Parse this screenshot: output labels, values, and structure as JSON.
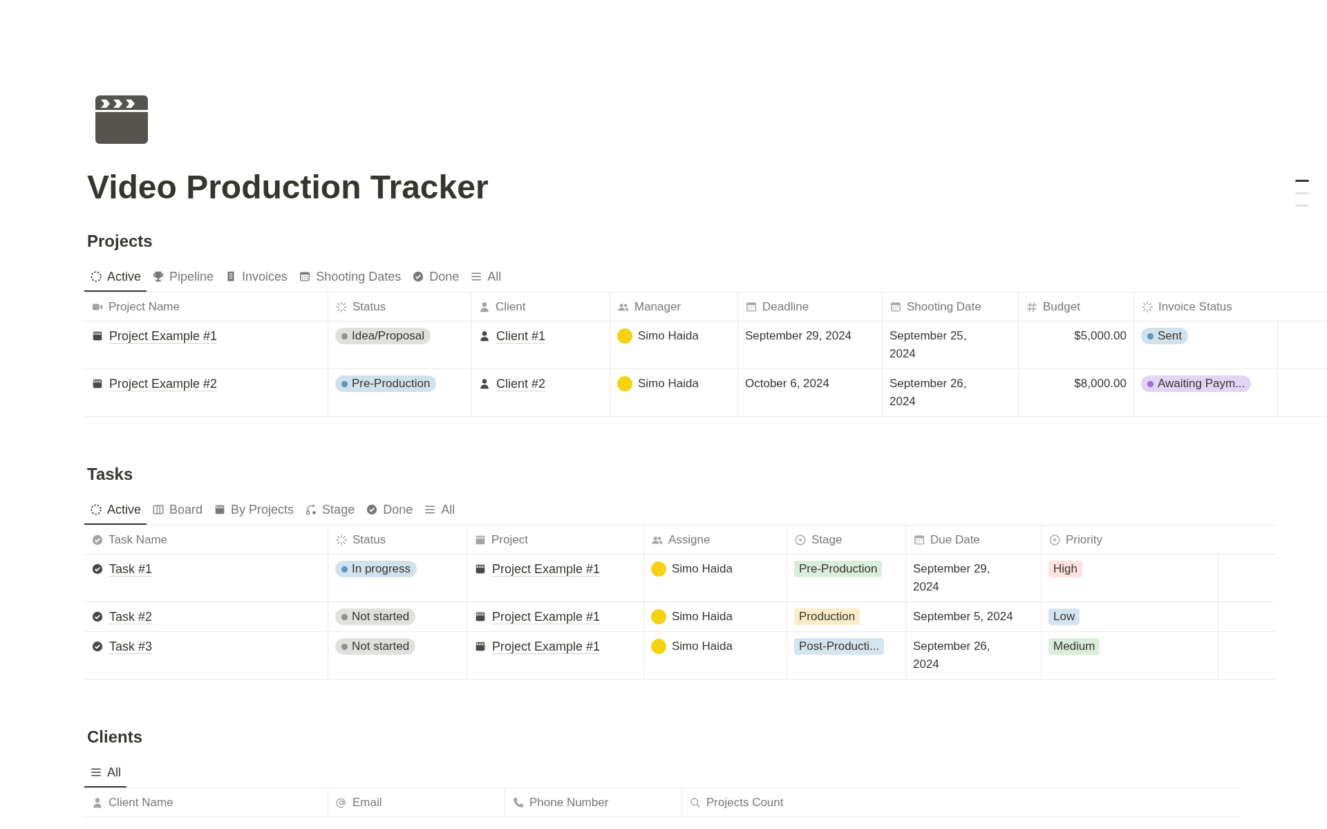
{
  "page": {
    "title": "Video Production Tracker"
  },
  "outline": [
    {
      "selected": true
    },
    {
      "selected": false
    },
    {
      "selected": false
    }
  ],
  "sections": [
    {
      "heading": "Projects",
      "views": [
        {
          "label": "Active",
          "kind": "active",
          "selected": true
        },
        {
          "label": "Pipeline",
          "kind": "trophy",
          "selected": false
        },
        {
          "label": "Invoices",
          "kind": "receipt",
          "selected": false
        },
        {
          "label": "Shooting Dates",
          "kind": "calendar",
          "selected": false
        },
        {
          "label": "Done",
          "kind": "done",
          "selected": false
        },
        {
          "label": "All",
          "kind": "list",
          "selected": false
        }
      ],
      "table": {
        "columns": [
          {
            "label": "Project Name",
            "kind": "video"
          },
          {
            "label": "Status",
            "kind": "status"
          },
          {
            "label": "Client",
            "kind": "person"
          },
          {
            "label": "Manager",
            "kind": "people"
          },
          {
            "label": "Deadline",
            "kind": "date"
          },
          {
            "label": "Shooting Date",
            "kind": "date"
          },
          {
            "label": "Budget",
            "kind": "number"
          },
          {
            "label": "Invoice Status",
            "kind": "status"
          }
        ],
        "rows": [
          {
            "cells": [
              {
                "kind": "project",
                "text": "Project Example #1"
              },
              {
                "kind": "status",
                "text": "Idea/Proposal",
                "color": "#91918e"
              },
              {
                "kind": "client",
                "text": "Client #1"
              },
              {
                "kind": "person",
                "text": "Simo Haida"
              },
              {
                "kind": "date",
                "text": "September 29, 2024"
              },
              {
                "kind": "date",
                "text": "September 25, 2024"
              },
              {
                "kind": "number",
                "text": "$5,000.00"
              },
              {
                "kind": "status",
                "text": "Sent",
                "color": "#5b97bd"
              }
            ]
          },
          {
            "cells": [
              {
                "kind": "project",
                "text": "Project Example #2"
              },
              {
                "kind": "status",
                "text": "Pre-Production",
                "color": "#5b97bd"
              },
              {
                "kind": "client",
                "text": "Client #2"
              },
              {
                "kind": "person",
                "text": "Simo Haida"
              },
              {
                "kind": "date",
                "text": "October 6, 2024"
              },
              {
                "kind": "date",
                "text": "September 26, 2024"
              },
              {
                "kind": "number",
                "text": "$8,000.00"
              },
              {
                "kind": "status",
                "text": "Awaiting Paym...",
                "color": "#9a6dd7"
              }
            ]
          }
        ]
      }
    },
    {
      "heading": "Tasks",
      "views": [
        {
          "label": "Active",
          "kind": "active",
          "selected": true
        },
        {
          "label": "Board",
          "kind": "board",
          "selected": false
        },
        {
          "label": "By Projects",
          "kind": "clapper",
          "selected": false
        },
        {
          "label": "Stage",
          "kind": "stage",
          "selected": false
        },
        {
          "label": "Done",
          "kind": "done",
          "selected": false
        },
        {
          "label": "All",
          "kind": "list",
          "selected": false
        }
      ],
      "table": {
        "columns": [
          {
            "label": "Task Name",
            "kind": "check"
          },
          {
            "label": "Status",
            "kind": "status"
          },
          {
            "label": "Project",
            "kind": "clapper"
          },
          {
            "label": "Assigne",
            "kind": "people"
          },
          {
            "label": "Stage",
            "kind": "select"
          },
          {
            "label": "Due Date",
            "kind": "date"
          },
          {
            "label": "Priority",
            "kind": "select"
          }
        ],
        "rows": [
          {
            "cells": [
              {
                "kind": "task",
                "text": "Task #1"
              },
              {
                "kind": "status",
                "text": "In progress",
                "color": "#5b97bd"
              },
              {
                "kind": "project",
                "text": "Project Example #1"
              },
              {
                "kind": "person",
                "text": "Simo Haida"
              },
              {
                "kind": "select",
                "text": "Pre-Production",
                "color": "#dbeddb"
              },
              {
                "kind": "date",
                "text": "September 29, 2024"
              },
              {
                "kind": "select",
                "text": "High",
                "color": "#ffe2dd"
              }
            ]
          },
          {
            "cells": [
              {
                "kind": "task",
                "text": "Task #2"
              },
              {
                "kind": "status",
                "text": "Not started",
                "color": "#91918e"
              },
              {
                "kind": "project",
                "text": "Project Example #1"
              },
              {
                "kind": "person",
                "text": "Simo Haida"
              },
              {
                "kind": "select",
                "text": "Production",
                "color": "#fdecc8"
              },
              {
                "kind": "date",
                "text": "September 5, 2024"
              },
              {
                "kind": "select",
                "text": "Low",
                "color": "#d3e5ef"
              }
            ]
          },
          {
            "cells": [
              {
                "kind": "task",
                "text": "Task #3"
              },
              {
                "kind": "status",
                "text": "Not started",
                "color": "#91918e"
              },
              {
                "kind": "project",
                "text": "Project Example #1"
              },
              {
                "kind": "person",
                "text": "Simo Haida"
              },
              {
                "kind": "select",
                "text": "Post-Producti...",
                "color": "#d3e5ef"
              },
              {
                "kind": "date",
                "text": "September 26, 2024"
              },
              {
                "kind": "select",
                "text": "Medium",
                "color": "#dbeddb"
              }
            ]
          }
        ]
      }
    },
    {
      "heading": "Clients",
      "views": [
        {
          "label": "All",
          "kind": "list",
          "selected": true
        }
      ],
      "table": {
        "columns": [
          {
            "label": "Client Name",
            "kind": "person"
          },
          {
            "label": "Email",
            "kind": "email"
          },
          {
            "label": "Phone Number",
            "kind": "phone"
          },
          {
            "label": "Projects Count",
            "kind": "rollup"
          }
        ]
      }
    }
  ]
}
